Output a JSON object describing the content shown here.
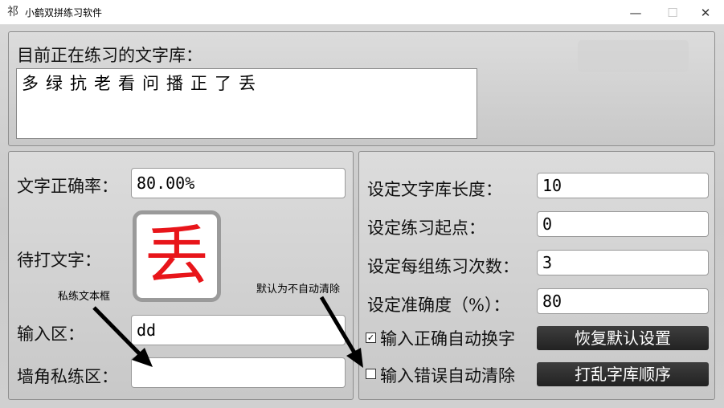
{
  "window": {
    "title": "小鹤双拼练习软件",
    "app_icon": "祁",
    "minimize": "—",
    "maximize": "☐",
    "close": "✕"
  },
  "library": {
    "label": "目前正在练习的文字库：",
    "content": "多绿抗老看问播正了丢"
  },
  "left": {
    "accuracy_label": "文字正确率：",
    "accuracy_value": "80.00%",
    "pending_label": "待打文字：",
    "current_char": "丢",
    "input_label": "输入区：",
    "input_value": "dd",
    "private_label": "墙角私练区：",
    "private_value": ""
  },
  "right": {
    "length_label": "设定文字库长度：",
    "length_value": "10",
    "start_label": "设定练习起点：",
    "start_value": "0",
    "repeat_label": "设定每组练习次数：",
    "repeat_value": "3",
    "accuracy_label": "设定准确度（%）：",
    "accuracy_value": "80",
    "auto_next_label": "输入正确自动换字",
    "auto_next_checked": true,
    "auto_clear_label": "输入错误自动清除",
    "auto_clear_checked": false,
    "reset_button": "恢复默认设置",
    "shuffle_button": "打乱字库顺序"
  },
  "annotations": {
    "private_box": "私练文本框",
    "auto_clear": "默认为不自动清除"
  },
  "colors": {
    "char_red": "#e8151a",
    "button_dark": "#2a2a2a"
  }
}
